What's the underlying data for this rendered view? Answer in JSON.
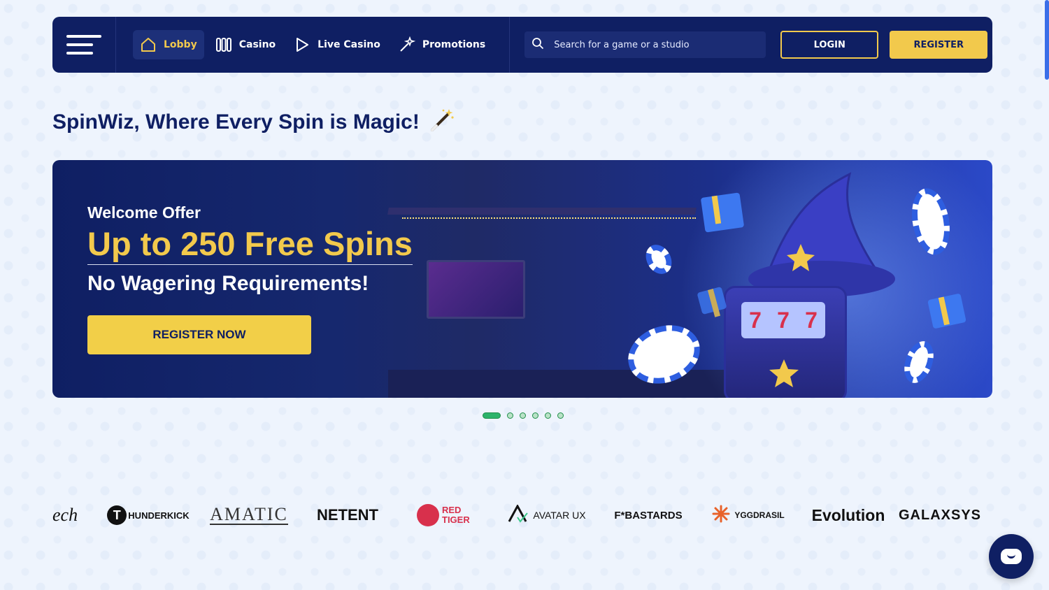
{
  "colors": {
    "navy": "#0f1f63",
    "accent": "#f2c94c",
    "page_bg": "#eef4fd",
    "dot_green": "#2db36a"
  },
  "nav": {
    "menu_icon": "hamburger-menu-icon",
    "links": [
      {
        "label": "Lobby",
        "icon": "home-icon",
        "active": true
      },
      {
        "label": "Casino",
        "icon": "slot-reels-icon",
        "active": false
      },
      {
        "label": "Live Casino",
        "icon": "play-icon",
        "active": false
      },
      {
        "label": "Promotions",
        "icon": "magic-wand-icon",
        "active": false
      }
    ],
    "search_placeholder": "Search for a game or a studio",
    "login_label": "LOGIN",
    "register_label": "REGISTER"
  },
  "headline": {
    "text": "SpinWiz, Where Every Spin is Magic!",
    "emoji": "🪄"
  },
  "banner": {
    "label": "Welcome Offer",
    "title": "Up to 250 Free Spins",
    "subtitle": "No Wagering Requirements!",
    "cta": "REGISTER NOW",
    "slot_symbols": [
      "7",
      "7",
      "7"
    ]
  },
  "carousel": {
    "count": 6,
    "active_index": 0
  },
  "providers": [
    "ech",
    "HUNDERKICK",
    "AMATIC",
    "NETENT",
    "RED TIGER",
    "AVATAR UX",
    "F*BASTARDS",
    "YGGDRASIL",
    "Evolution",
    "GALAXSYS"
  ],
  "chat_icon": "chat-bubble-icon"
}
